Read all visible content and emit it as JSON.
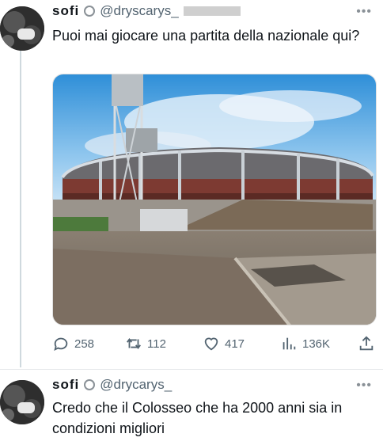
{
  "tweets": [
    {
      "display_name": "sofi",
      "handle": "@dryscarys_",
      "text": "Puoi mai giocare una partita della nazionale qui?",
      "stats": {
        "replies": "258",
        "retweets": "112",
        "likes": "417",
        "views": "136K"
      }
    },
    {
      "display_name": "sofi",
      "handle": "@drycarys_",
      "text": "Credo che il Colosseo che ha 2000 anni sia in condizioni migliori"
    }
  ],
  "icons": {
    "more": "more-dots-icon",
    "reply": "reply-icon",
    "retweet": "retweet-icon",
    "like": "heart-icon",
    "views": "views-chart-icon",
    "share": "share-icon",
    "verified": "verified-badge-icon"
  },
  "colors": {
    "text": "#0f1419",
    "secondary": "#536471",
    "border": "#e6e9eb"
  }
}
